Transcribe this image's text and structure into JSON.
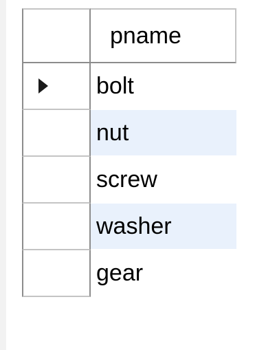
{
  "grid": {
    "columns": [
      {
        "label": "pname"
      }
    ],
    "rows": [
      {
        "pname": "bolt",
        "current": true
      },
      {
        "pname": "nut",
        "current": false
      },
      {
        "pname": "screw",
        "current": false
      },
      {
        "pname": "washer",
        "current": false
      },
      {
        "pname": "gear",
        "current": false
      }
    ]
  },
  "colors": {
    "alt_row_bg": "#e9f1fc",
    "grid_line": "#8c8c8c",
    "indicator_arrow": "#1a1a1a"
  },
  "icons": {
    "current_row": "triangle-right-icon"
  }
}
